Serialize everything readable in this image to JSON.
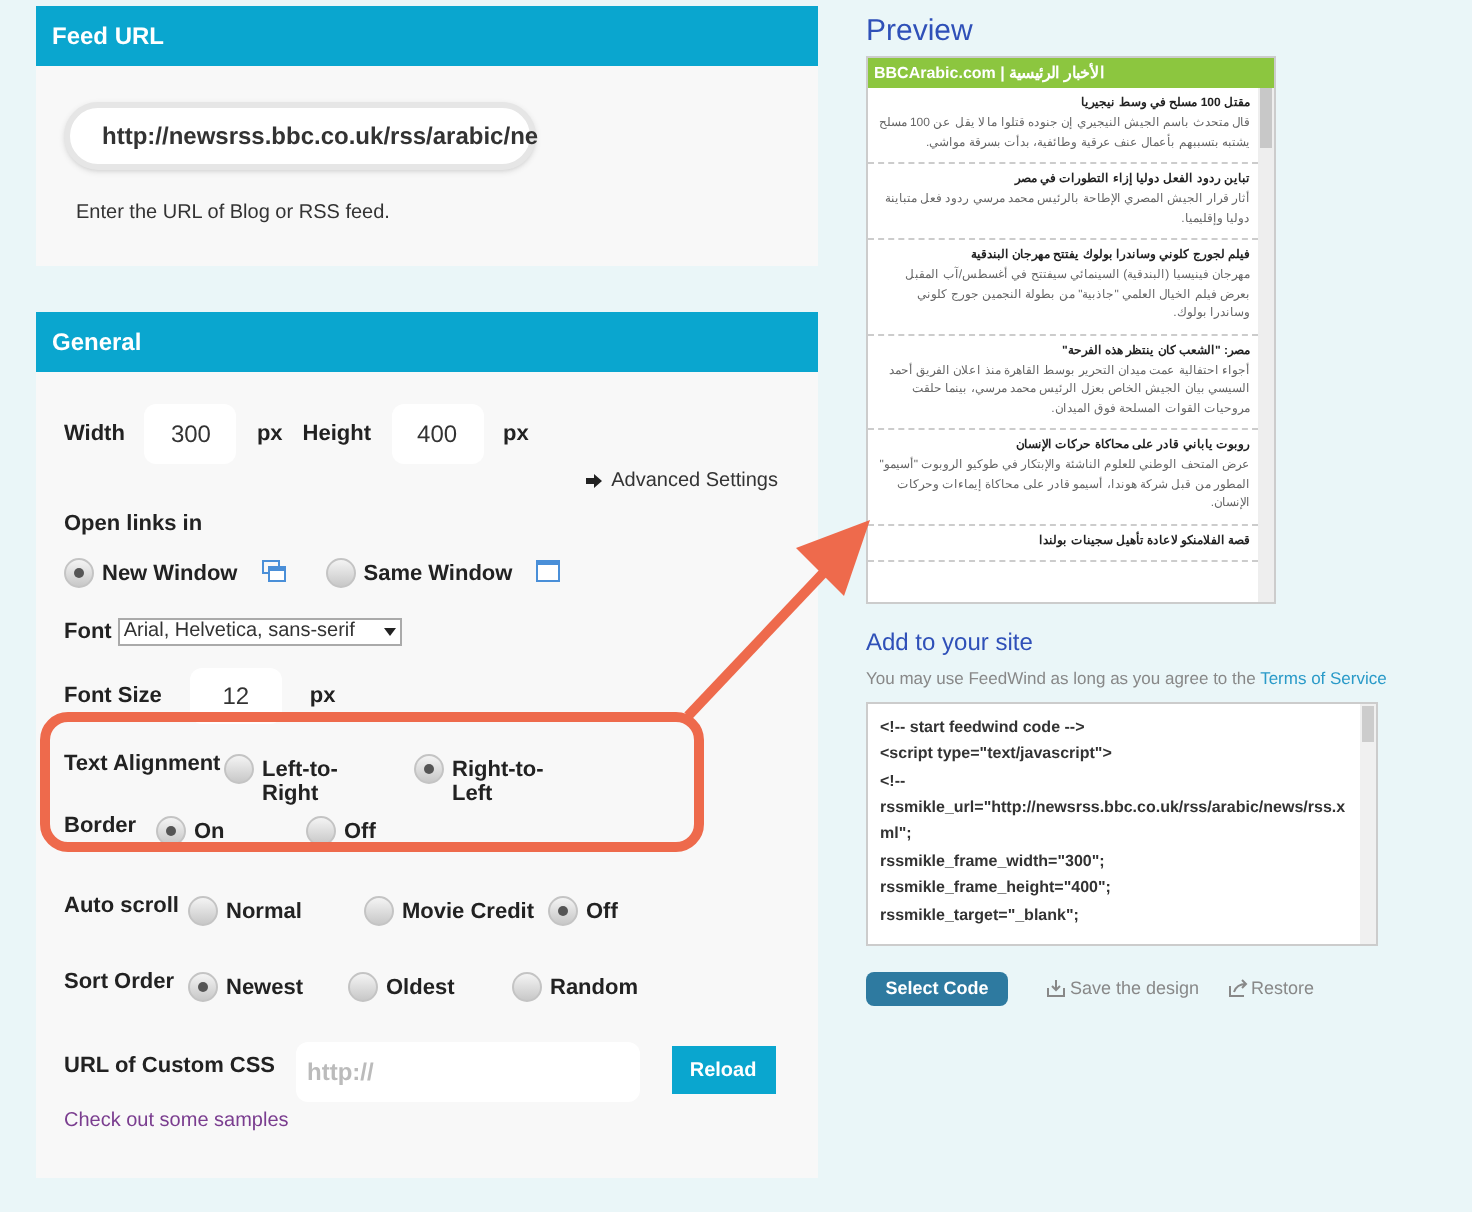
{
  "feed_url": {
    "title": "Feed URL",
    "value": "http://newsrss.bbc.co.uk/rss/arabic/ne",
    "hint": "Enter the URL of Blog or RSS feed."
  },
  "general": {
    "title": "General",
    "width": {
      "label": "Width",
      "value": "300",
      "unit": "px"
    },
    "height": {
      "label": "Height",
      "value": "400",
      "unit": "px"
    },
    "advanced": "Advanced Settings",
    "open_links": {
      "label": "Open links in",
      "options": [
        {
          "label": "New Window",
          "selected": true
        },
        {
          "label": "Same Window",
          "selected": false
        }
      ]
    },
    "font": {
      "label": "Font",
      "value": "Arial, Helvetica, sans-serif"
    },
    "font_size": {
      "label": "Font Size",
      "value": "12",
      "unit": "px"
    },
    "radio_groups": [
      {
        "label": "Text Alignment",
        "options": [
          {
            "label": "Left-to-\nRight",
            "selected": false
          },
          {
            "label": "Right-to-\nLeft",
            "selected": true
          }
        ]
      },
      {
        "label": "Border",
        "options": [
          {
            "label": "On",
            "selected": true
          },
          {
            "label": "Off",
            "selected": false
          }
        ]
      },
      {
        "label": "Auto scroll",
        "options": [
          {
            "label": "Normal",
            "selected": false
          },
          {
            "label": "Movie Credit",
            "selected": false
          },
          {
            "label": "Off",
            "selected": true
          }
        ]
      },
      {
        "label": "Sort Order",
        "options": [
          {
            "label": "Newest",
            "selected": true
          },
          {
            "label": "Oldest",
            "selected": false
          },
          {
            "label": "Random",
            "selected": false
          }
        ]
      }
    ],
    "custom_css": {
      "label": "URL of Custom CSS",
      "placeholder": "http://",
      "button": "Reload"
    },
    "samples_link": "Check out some samples"
  },
  "preview": {
    "title": "Preview",
    "widget_title": "الأخبار الرئيسية | BBCArabic.com",
    "items": [
      {
        "title": "مقتل 100 مسلح في وسط نيجيريا",
        "body": "قال متحدث باسم الجيش النيجيري إن جنوده قتلوا ما لا يقل عن 100 مسلح يشتبه بتسببهم بأعمال عنف عرقية وطائفية، بدأت بسرقة مواشي."
      },
      {
        "title": "تباين ردود الفعل دوليا إزاء التطورات في مصر",
        "body": "أثار قرار الجيش المصري الإطاحة بالرئيس محمد مرسي ردود فعل متباينة دوليا وإقليميا."
      },
      {
        "title": "فيلم لجورج كلوني وساندرا بولوك يفتتح مهرجان البندقية",
        "body": "مهرجان فينيسيا (البندقية) السينمائي سيفتتح في أغسطس/آب المقبل بعرض فيلم الخيال العلمي \"جاذبية\" من بطولة النجمين جورج كلوني وساندرا بولوك."
      },
      {
        "title": "مصر: \"الشعب كان ينتظر هذه الفرحة\"",
        "body": "أجواء احتفالية عمت ميدان التحرير بوسط القاهرة منذ اعلان الفريق أحمد السيسي بيان الجيش الخاص بعزل الرئيس محمد مرسي، بينما حلقت مروحيات القوات المسلحة فوق الميدان."
      },
      {
        "title": "روبوت ياباني قادر على محاكاة حركات الإنسان",
        "body": "عرض المتحف الوطني للعلوم الناشئة والإبتكار في طوكيو الروبوت \"أسيمو\" المطور من قبل شركة هوندا، أسيمو قادر على محاكاة إيماءات وحركات الإنسان."
      },
      {
        "title": "قصة الفلامنكو لاعادة تأهيل سجينات بولندا"
      }
    ]
  },
  "add_site": {
    "title": "Add to your site",
    "notice": "You may use FeedWind as long as you agree to the",
    "terms": "Terms of Service",
    "code": "<!-- start feedwind code -->\n<script type=\"text/javascript\">\n<!--\nrssmikle_url=\"http://newsrss.bbc.co.uk/rss/arabic/news/rss.xml\";\nrssmikle_frame_width=\"300\";\nrssmikle_frame_height=\"400\";\nrssmikle_target=\"_blank\";",
    "buttons": [
      {
        "kind": "primary",
        "label": "Select Code"
      },
      {
        "kind": "save",
        "label": "Save the design"
      },
      {
        "kind": "restore",
        "label": "Restore"
      }
    ]
  }
}
